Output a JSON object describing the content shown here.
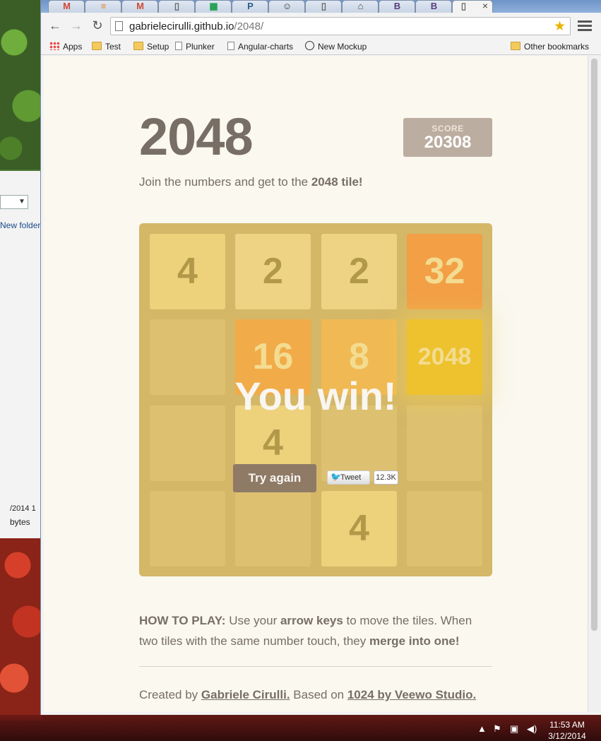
{
  "desktop": {
    "explorer": {
      "new_folder": "New folder",
      "date_fragment": "/2014 1",
      "bytes_fragment": "bytes"
    }
  },
  "browser": {
    "tabs": [
      {
        "icon": "gmail-icon",
        "glyph": "M",
        "color": "#d14836"
      },
      {
        "icon": "stackoverflow-icon",
        "glyph": "≡",
        "color": "#e2852b"
      },
      {
        "icon": "gmail-icon",
        "glyph": "M",
        "color": "#d14836"
      },
      {
        "icon": "page-icon",
        "glyph": "▯",
        "color": "#666666"
      },
      {
        "icon": "sheets-icon",
        "glyph": "▦",
        "color": "#1a9c4a"
      },
      {
        "icon": "p-icon",
        "glyph": "P",
        "color": "#2a5f8a"
      },
      {
        "icon": "smiley-icon",
        "glyph": "☺",
        "color": "#333333"
      },
      {
        "icon": "page-icon",
        "glyph": "▯",
        "color": "#666666"
      },
      {
        "icon": "home-icon",
        "glyph": "⌂",
        "color": "#444444"
      },
      {
        "icon": "bootstrap-icon",
        "glyph": "B",
        "color": "#563d7c"
      },
      {
        "icon": "bootstrap-icon",
        "glyph": "B",
        "color": "#563d7c"
      },
      {
        "icon": "page-icon",
        "glyph": "▯",
        "color": "#666666",
        "active": true
      }
    ],
    "url_host": "gabrielecirulli.github.io",
    "url_path": "/2048/",
    "bookmarks": {
      "apps": "Apps",
      "items": [
        "Test",
        "Setup",
        "Plunker",
        "Angular-charts",
        "New Mockup"
      ],
      "other": "Other bookmarks"
    }
  },
  "page": {
    "title": "2048",
    "score_label": "SCORE",
    "score_value": "20308",
    "intro_text": "Join the numbers and get to the ",
    "intro_bold": "2048 tile!",
    "board": [
      [
        "4",
        "2",
        "2",
        "32"
      ],
      [
        "",
        "16",
        "8",
        "2048"
      ],
      [
        "",
        "4",
        "",
        ""
      ],
      [
        "",
        "",
        "4",
        ""
      ]
    ],
    "win_message": "You win!",
    "try_again": "Try again",
    "tweet_label": "Tweet",
    "tweet_count": "12.3K",
    "howto": {
      "label": "HOW TO PLAY:",
      "t1": " Use your ",
      "b1": "arrow keys",
      "t2": " to move the tiles. When two tiles with the same number touch, they ",
      "b2": "merge into one!"
    },
    "credits": {
      "prefix": "Created by ",
      "author": "Gabriele Cirulli.",
      "middle": " Based on ",
      "based_on": "1024 by Veewo Studio."
    }
  },
  "taskbar": {
    "time": "11:53 AM",
    "date": "3/12/2014"
  }
}
